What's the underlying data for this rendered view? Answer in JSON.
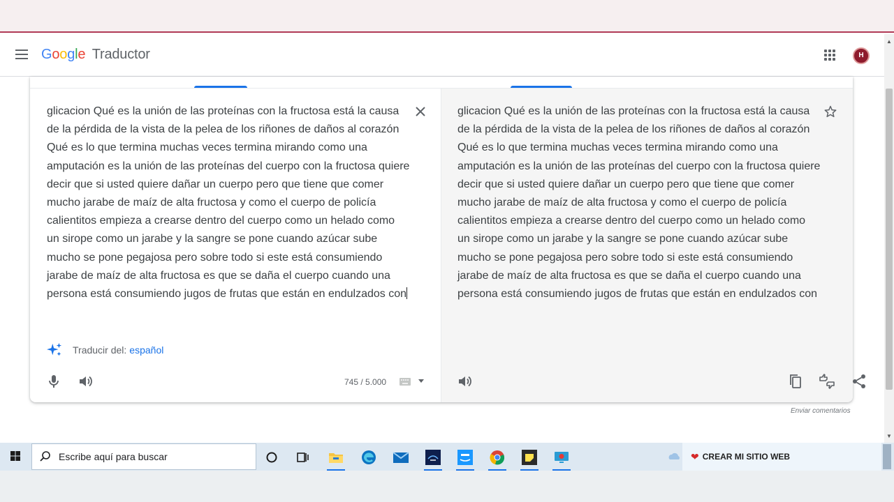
{
  "app": {
    "logo_letters": [
      "G",
      "o",
      "o",
      "g",
      "l",
      "e"
    ],
    "product_name": "Traductor",
    "avatar_initials": "H"
  },
  "source": {
    "text": "glicacion Qué es la unión de las proteínas con la fructosa está la causa de la pérdida de la vista de la pelea de los riñones de daños al corazón Qué es lo que termina muchas veces termina mirando como una amputación es la unión de las proteínas del cuerpo con la fructosa quiere decir que si usted quiere dañar un cuerpo pero que tiene que comer mucho jarabe de maíz de alta fructosa y como el cuerpo de policía calientitos empieza a crearse dentro del cuerpo como un helado como un sirope como un jarabe y la sangre se pone cuando azúcar sube mucho se pone pegajosa pero sobre todo si este está consumiendo jarabe de maíz de alta fructosa es que se daña el cuerpo cuando una persona está consumiendo jugos de frutas que están en endulzados con",
    "detect_label": "Traducir del:",
    "detect_language": "español",
    "char_count": "745 / 5.000"
  },
  "target": {
    "text": "glicacion Qué es la unión de las proteínas con la fructosa está la causa de la pérdida de la vista de la pelea de los riñones de daños al corazón Qué es lo que termina muchas veces termina mirando como una amputación es la unión de las proteínas del cuerpo con la fructosa quiere decir que si usted quiere dañar un cuerpo pero que tiene que comer mucho jarabe de maíz de alta fructosa y como el cuerpo de policía calientitos empieza a crearse dentro del cuerpo como un helado como un sirope como un jarabe y la sangre se pone cuando azúcar sube mucho se pone pegajosa pero sobre todo si este está consumiendo jarabe de maíz de alta fructosa es que se daña el cuerpo cuando una persona está consumiendo jugos de frutas que están en endulzados con"
  },
  "feedback": "Enviar comentarios",
  "taskbar": {
    "search_placeholder": "Escribe aquí para buscar",
    "promo_label": "CREAR MI SITIO WEB",
    "icons": [
      "windows-icon",
      "cortana-icon",
      "task-view-icon",
      "file-explorer-icon",
      "edge-icon",
      "mail-icon",
      "disney-plus-icon",
      "prime-video-icon",
      "chrome-icon",
      "sticky-notes-icon",
      "screen-recorder-icon"
    ]
  },
  "colors": {
    "accent": "#1a73e8",
    "browser_accent": "#b03a56",
    "target_bg": "#f5f5f5",
    "taskbar_bg": "#dde8f2"
  }
}
